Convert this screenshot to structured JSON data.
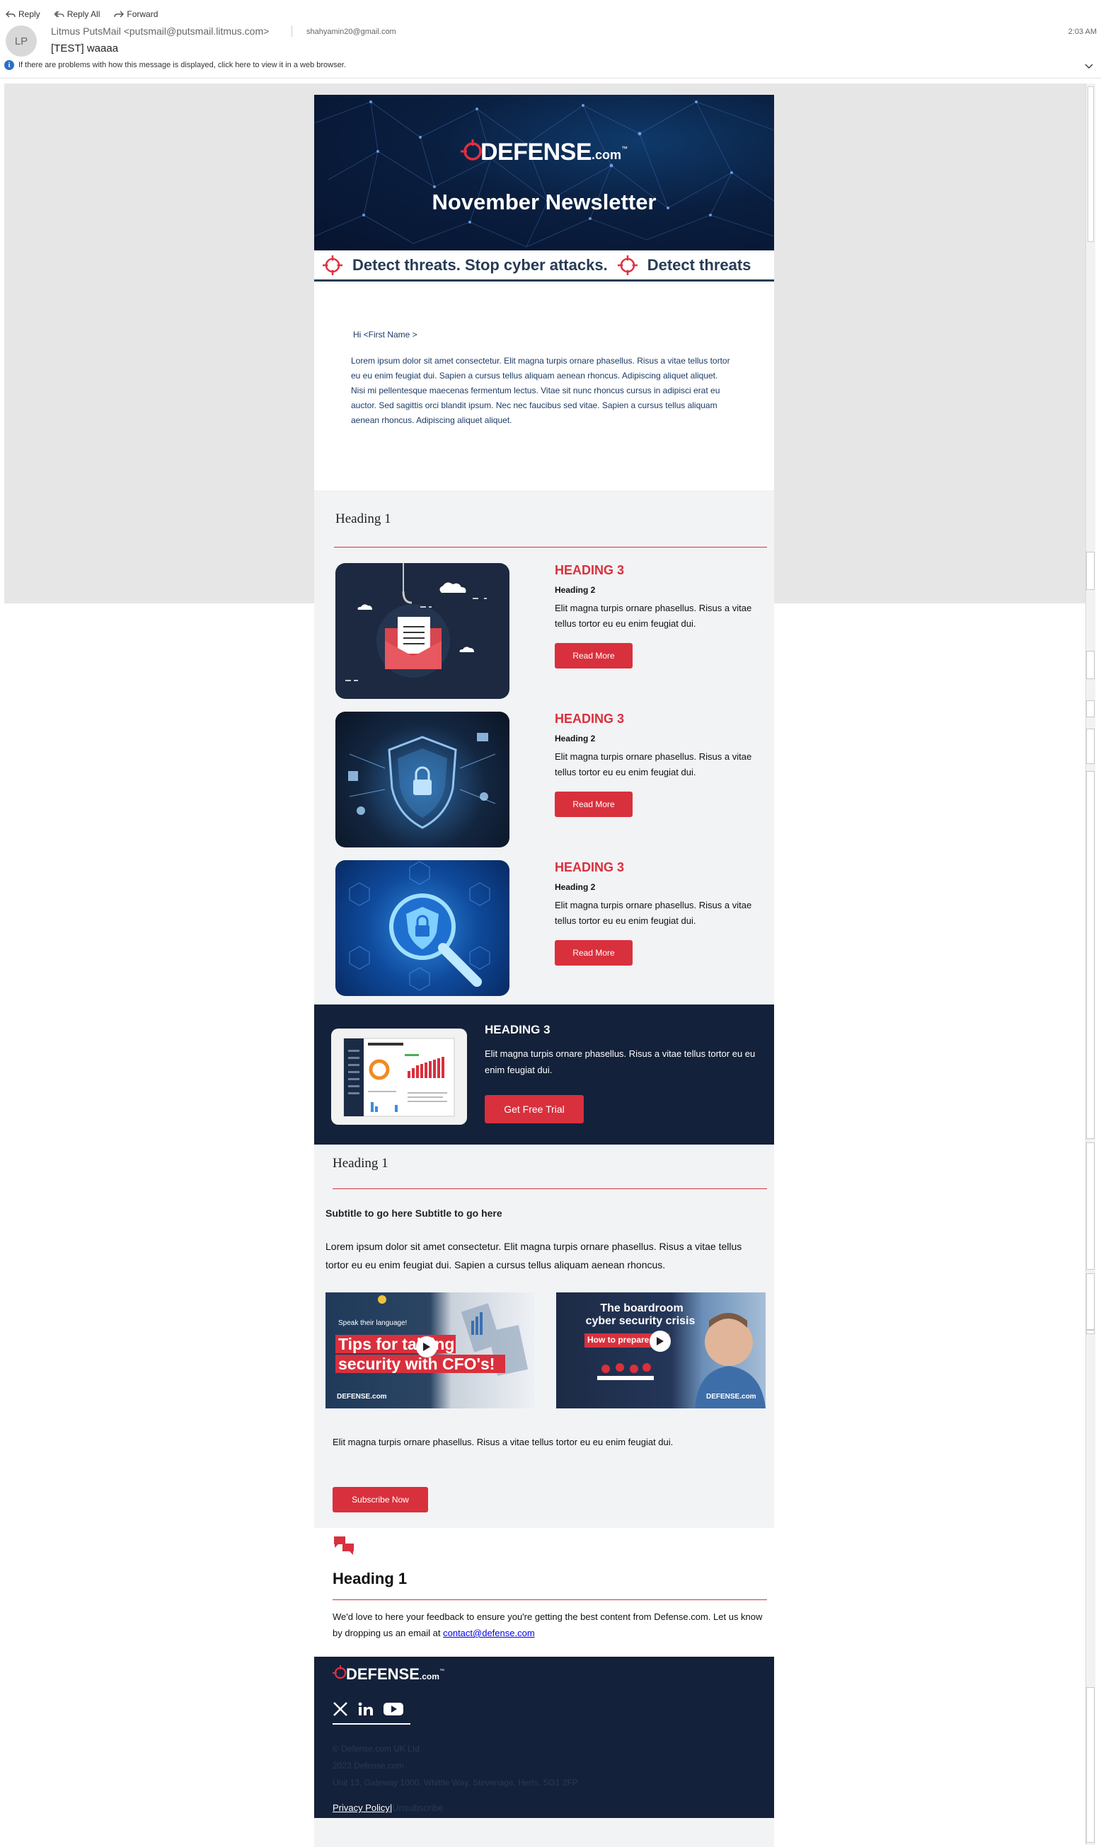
{
  "toolbar": {
    "reply": "Reply",
    "reply_all": "Reply All",
    "forward": "Forward"
  },
  "message": {
    "avatar_initials": "LP",
    "from": "Litmus PutsMail <putsmail@putsmail.litmus.com>",
    "to": "shahyamin20@gmail.com",
    "time": "2:03 AM",
    "subject": "[TEST] waaaa",
    "info": "If there are problems with how this message is displayed, click here to view it in a web browser."
  },
  "banner": {
    "brand": "DEFENSE",
    "brand_suffix": ".com",
    "tm": "™",
    "title": "November Newsletter",
    "ticker_1": "Detect threats. Stop cyber attacks.",
    "ticker_2": "Detect threats"
  },
  "intro": {
    "greeting": "Hi <First Name >",
    "paragraph_1": "Lorem ipsum dolor sit amet consectetur. Elit magna turpis ornare phasellus. Risus a vitae tellus tortor eu eu enim feugiat dui. Sapien a cursus tellus aliquam aenean rhoncus. Adipiscing aliquet aliquet.",
    "paragraph_2": "Nisi mi pellentesque maecenas fermentum lectus. Vitae sit nunc rhoncus cursus in adipisci erat eu auctor. Sed sagittis orci blandit ipsum. Nec nec faucibus sed vitae. Sapien a cursus tellus aliquam aenean rhoncus. Adipiscing aliquet aliquet."
  },
  "section1": {
    "heading": "Heading 1",
    "cards": [
      {
        "h3": "HEADING 3",
        "h2": "Heading 2",
        "text": "Elit magna turpis ornare phasellus. Risus a vitae tellus tortor eu eu enim feugiat dui.",
        "button": "Read More",
        "image": "phishing-envelope-icon"
      },
      {
        "h3": "HEADING 3",
        "h2": "Heading 2",
        "text": "Elit magna turpis ornare phasellus. Risus a vitae tellus tortor eu eu enim feugiat dui.",
        "button": "Read More",
        "image": "cyber-shield-icon"
      },
      {
        "h3": "HEADING 3",
        "h2": "Heading 2",
        "text": "Elit magna turpis ornare phasellus. Risus a vitae tellus tortor eu eu enim feugiat dui.",
        "button": "Read More",
        "image": "magnifier-lock-icon"
      }
    ]
  },
  "promo": {
    "h3": "HEADING 3",
    "text": "Elit magna turpis ornare phasellus. Risus a vitae tellus tortor eu eu enim feugiat dui.",
    "button": "Get Free Trial"
  },
  "section2": {
    "heading": "Heading 1",
    "subtitle": "Subtitle to go here Subtitle to go here",
    "text": "Lorem ipsum dolor sit amet consectetur. Elit magna turpis ornare phasellus. Risus a vitae tellus tortor eu eu enim feugiat dui. Sapien a cursus tellus aliquam aenean rhoncus.",
    "video_1": {
      "kicker": "Speak their language!",
      "line1": "Tips for talking",
      "line2": "security with CFO's!",
      "brand": "DEFENSE.com"
    },
    "video_2": {
      "line1": "The boardroom",
      "line2": "cyber security crisis",
      "line3": "How to prepare",
      "brand": "DEFENSE.com"
    },
    "caption": "Elit magna turpis ornare phasellus. Risus a vitae tellus tortor eu eu enim feugiat dui.",
    "button": "Subscribe Now"
  },
  "feedback": {
    "heading": "Heading 1",
    "text": "We'd love to here your feedback to ensure you're getting the best content from Defense.com. Let us know by dropping us an email at ",
    "email": "contact@defense.com"
  },
  "footer": {
    "brand": "DEFENSE",
    "brand_suffix": ".com",
    "tm": "™",
    "line1": "© Defense.com UK Ltd",
    "line2": "2023 Defense.com",
    "line3": "Unit 13, Gateway 1000, Whittle Way, Stevenage, Herts, SG1 2FP",
    "privacy": "Privacy Policy",
    "divider": "|",
    "unsubscribe": "Unsubscribe"
  },
  "colors": {
    "brand_red": "#d9303d",
    "navy": "#13213a",
    "panel_gray": "#f2f3f5"
  }
}
